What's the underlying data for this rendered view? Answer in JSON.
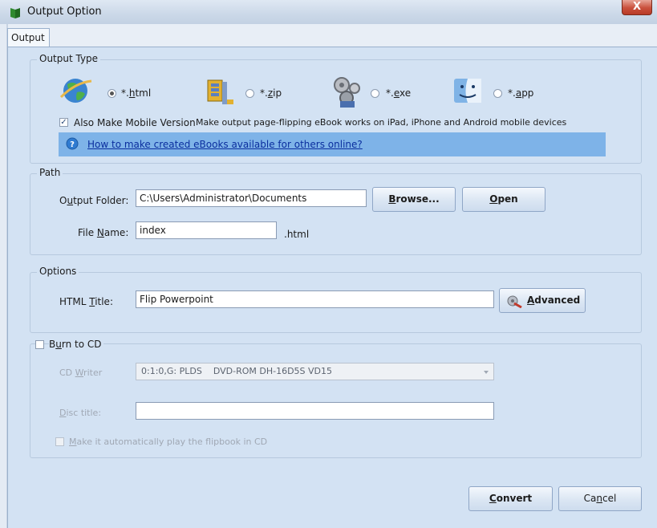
{
  "window": {
    "title": "Output Option",
    "close_label": "X"
  },
  "tabs": [
    {
      "label": "Output"
    }
  ],
  "output_type": {
    "group_label": "Output Type",
    "options": [
      {
        "label_pre": "*.",
        "label_ul": "h",
        "label_post": "tml",
        "selected": true,
        "icon": "globe-icon"
      },
      {
        "label_pre": "*.",
        "label_ul": "z",
        "label_post": "ip",
        "selected": false,
        "icon": "zip-archive-icon"
      },
      {
        "label_pre": "*.",
        "label_ul": "e",
        "label_post": "xe",
        "selected": false,
        "icon": "gears-icon"
      },
      {
        "label_pre": "*.",
        "label_ul": "a",
        "label_post": "pp",
        "selected": false,
        "icon": "mac-finder-icon"
      }
    ],
    "mobile_checkbox_label": "Also Make Mobile Version",
    "mobile_checked": true,
    "mobile_description": "Make output page-flipping eBook works on iPad, iPhone and Android mobile devices",
    "help_link": "How to make created eBooks available for others online?"
  },
  "path": {
    "group_label": "Path",
    "output_folder_label_pre": "O",
    "output_folder_label_ul": "u",
    "output_folder_label_post": "tput Folder:",
    "output_folder_value": "C:\\Users\\Administrator\\Documents",
    "browse_label_ul": "B",
    "browse_label_post": "rowse...",
    "open_label_ul": "O",
    "open_label_post": "pen",
    "file_name_label_pre": "File ",
    "file_name_label_ul": "N",
    "file_name_label_post": "ame:",
    "file_name_value": "index",
    "file_ext": ".html"
  },
  "options": {
    "group_label": "Options",
    "html_title_label_pre": "HTML ",
    "html_title_label_ul": "T",
    "html_title_label_post": "itle:",
    "html_title_value": "Flip Powerpoint",
    "advanced_label_ul": "A",
    "advanced_label_post": "dvanced"
  },
  "burn": {
    "checkbox_label_pre": "B",
    "checkbox_label_ul": "u",
    "checkbox_label_post": "rn to CD",
    "checked": false,
    "cd_writer_label_pre": "CD ",
    "cd_writer_label_ul": "W",
    "cd_writer_label_post": "riter",
    "cd_writer_value": "0:1:0,G: PLDS    DVD-ROM DH-16D5S VD15",
    "disc_title_label_ul": "D",
    "disc_title_label_post": "isc title:",
    "disc_title_value": "",
    "autoplay_label_ul": "M",
    "autoplay_label_post": "ake it automatically play the flipbook in CD"
  },
  "footer": {
    "convert_label_ul": "C",
    "convert_label_post": "onvert",
    "cancel_label_pre": "Ca",
    "cancel_label_ul": "n",
    "cancel_label_post": "cel"
  }
}
